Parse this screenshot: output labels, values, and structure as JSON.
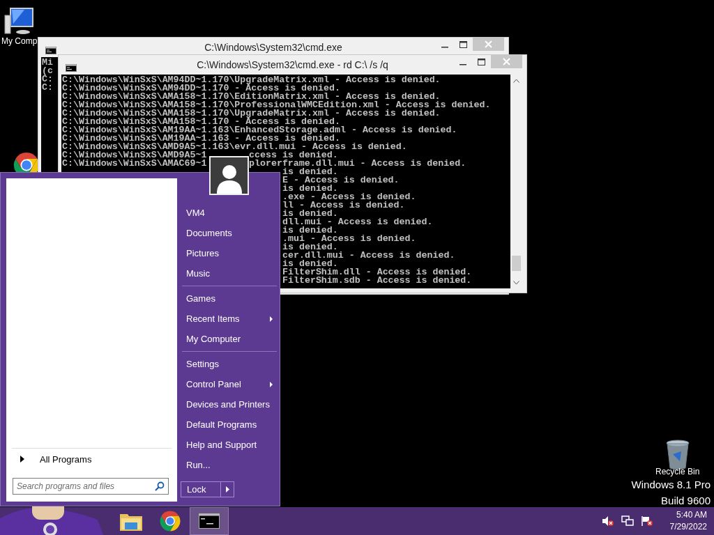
{
  "desktop_icons": [
    {
      "kind": "computer",
      "label": "My Comp"
    },
    {
      "kind": "browser"
    },
    {
      "kind": "recycle-bin",
      "label": "Recycle Bin"
    }
  ],
  "windows": [
    {
      "title": "C:\\Windows\\System32\\cmd.exe",
      "lines": [
        {
          "left": "Mi"
        },
        {
          "left": "(c"
        },
        {
          "left": "C:"
        },
        {
          "left": "C:"
        }
      ]
    },
    {
      "title": "C:\\Windows\\System32\\cmd.exe - rd  C:\\ /s /q",
      "lines": [
        {
          "left": "C:\\Windows\\WinSxS\\AM94DD~1.170\\UpgradeMatrix.xml - Access is denied."
        },
        {
          "left": "C:\\Windows\\WinSxS\\AM94DD~1.170 - Access is denied."
        },
        {
          "left": "C:\\Windows\\WinSxS\\AMA158~1.170\\EditionMatrix.xml - Access is denied."
        },
        {
          "left": "C:\\Windows\\WinSxS\\AMA158~1.170\\ProfessionalWMCEdition.xml - Access is denied."
        },
        {
          "left": "C:\\Windows\\WinSxS\\AMA158~1.170\\UpgradeMatrix.xml - Access is denied."
        },
        {
          "left": "C:\\Windows\\WinSxS\\AMA158~1.170 - Access is denied."
        },
        {
          "left": "C:\\Windows\\WinSxS\\AM19AA~1.163\\EnhancedStorage.adml - Access is denied."
        },
        {
          "left": "C:\\Windows\\WinSxS\\AM19AA~1.163 - Access is denied."
        },
        {
          "left": "C:\\Windows\\WinSxS\\AMD9A5~1.163\\evr.dll.mui - Access is denied."
        },
        {
          "left": "C:\\Windows\\WinSxS\\AMD9A5~1",
          "right": "ccess is denied."
        },
        {
          "left": "C:\\Windows\\WinSxS\\AMAC69~1",
          "right": "plorerframe.dll.mui - Access is denied."
        },
        {
          "right": "is denied."
        },
        {
          "right": "E - Access is denied."
        },
        {
          "right": "is denied."
        },
        {
          "right": ".exe - Access is denied."
        },
        {
          "right": "ll - Access is denied."
        },
        {
          "right": "is denied."
        },
        {
          "right": "dll.mui - Access is denied."
        },
        {
          "right": "is denied."
        },
        {
          "right": ".mui - Access is denied."
        },
        {
          "right": "is denied."
        },
        {
          "right": "cer.dll.mui - Access is denied."
        },
        {
          "right": "is denied."
        },
        {
          "right": "FilterShim.dll - Access is denied."
        },
        {
          "right": "FilterShim.sdb - Access is denied."
        }
      ]
    }
  ],
  "start_menu": {
    "all_programs": "All Programs",
    "search": {
      "placeholder": "Search programs and files"
    },
    "groups": [
      [
        {
          "label": "VM4",
          "submenu": false
        },
        {
          "label": "Documents",
          "submenu": false
        },
        {
          "label": "Pictures",
          "submenu": false
        },
        {
          "label": "Music",
          "submenu": false
        }
      ],
      [
        {
          "label": "Games",
          "submenu": false
        },
        {
          "label": "Recent Items",
          "submenu": true
        },
        {
          "label": "My Computer",
          "submenu": false
        }
      ],
      [
        {
          "label": "Settings",
          "submenu": false
        },
        {
          "label": "Control Panel",
          "submenu": true
        },
        {
          "label": "Devices and Printers",
          "submenu": false
        },
        {
          "label": "Default Programs",
          "submenu": false
        },
        {
          "label": "Help and Support",
          "submenu": false
        },
        {
          "label": "Run...",
          "submenu": false
        }
      ]
    ],
    "lock_button": "Lock"
  },
  "watermark": {
    "edition": "Windows 8.1 Pro",
    "build": "Build 9600"
  },
  "taskbar": {
    "items": [
      {
        "kind": "explorer",
        "selected": false
      },
      {
        "kind": "browser",
        "selected": false
      },
      {
        "kind": "console",
        "selected": true
      }
    ],
    "clock": {
      "time": "5:40 AM",
      "date": "7/29/2022"
    }
  }
}
